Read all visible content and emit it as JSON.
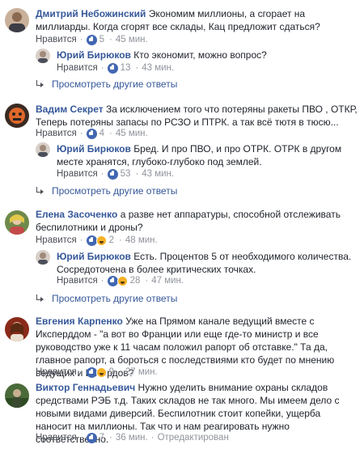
{
  "comments": [
    {
      "author": "Дмитрий Небожинский",
      "text": "Экономим миллионы, а сгорает на миллиарды. Когда сгорят все склады, Кац предложит сдаться?",
      "like_label": "Нравится",
      "reactions": "5",
      "time": "45 мин.",
      "reply": {
        "author": "Юрий Бирюков",
        "text": "Кто экономит, можно вопрос?",
        "like_label": "Нравится",
        "reactions": "13",
        "time": "43 мин."
      },
      "more_label": "Просмотреть другие ответы"
    },
    {
      "author": "Вадим Секрет",
      "text": "За исключением того что потеряны ракеты ПВО , ОТКР, Теперь потеряны запасы по РСЗО и ПТРК. а так всё тютя в тюсю...",
      "like_label": "Нравится",
      "reactions": "4",
      "time": "45 мин.",
      "reply": {
        "author": "Юрий Бирюков",
        "text": "Бред. И про ПВО, и про ОТРК. ОТРК в другом месте хранятся, глубоко-глубоко под землей.",
        "like_label": "Нравится",
        "reactions": "53",
        "time": "43 мин."
      },
      "more_label": "Просмотреть другие ответы"
    },
    {
      "author": "Елена Засоченко",
      "text": "а разве нет аппаратуры, способной отслеживать беспилотники и дроны?",
      "like_label": "Нравится",
      "reactions": "2",
      "time": "48 мин.",
      "reply": {
        "author": "Юрий Бирюков",
        "text": "Есть. Процентов 5 от необходимого количества. Сосредоточена в более критических точках.",
        "like_label": "Нравится",
        "reactions": "28",
        "time": "47 мин."
      },
      "more_label": "Просмотреть другие ответы"
    },
    {
      "author": "Евгения Карпенко",
      "text": "Уже на Прямом канале ведущий вместе с Иксперддом - \"а вот во Франции или еще где-то министр и все руководство уже к 11 часам положил рапорт об отставке.\" Та да, главное рапорт, а бороться с последствиями кто будет по мнению ведущих и Иксердов?",
      "like_label": "Нравится",
      "reactions": "9",
      "time": "27 мин."
    },
    {
      "author": "Виктор Геннадьевич",
      "text": "Нужно уделить внимание охраны складов средствами РЭБ т.д. Таких складов не так много. Мы имеем дело с новыми видами диверсий. Беспилотник стоит копейки, ущерба наносит на миллионы. Так что и нам реагировать нужно соответственно.",
      "like_label": "Нравится",
      "reactions": "7",
      "time": "36 мин.",
      "edited": "Отредактирован"
    }
  ],
  "colors": {
    "link": "#365899",
    "meta": "#90949c",
    "like": "#4267b2",
    "divider": "#e9ebee"
  }
}
